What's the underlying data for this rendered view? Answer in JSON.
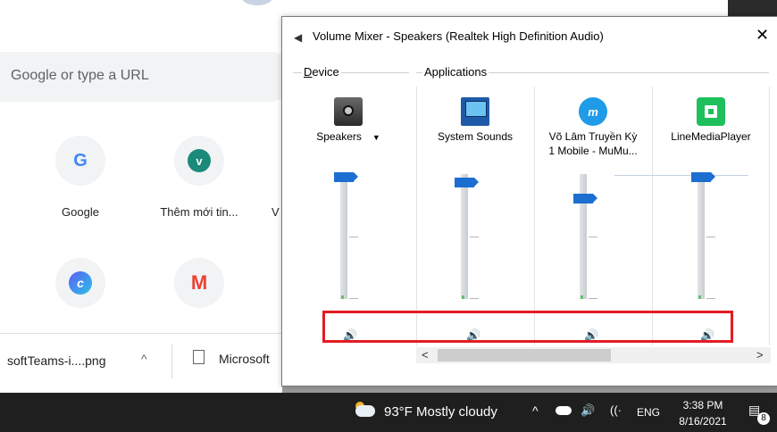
{
  "chrome": {
    "omnibox_placeholder": "Google or type a URL",
    "shortcuts": [
      {
        "label": "Google",
        "icon": "google-icon"
      },
      {
        "label": "Thêm mới tin...",
        "icon": "v-letter-icon"
      },
      {
        "label": "V",
        "icon": ""
      },
      {
        "label": "",
        "icon": "canva-icon"
      },
      {
        "label": "",
        "icon": "gmail-icon"
      }
    ],
    "downloads": [
      {
        "label": "softTeams-i....png"
      },
      {
        "label": "Microsoft"
      }
    ]
  },
  "mixer": {
    "title": "Volume Mixer - Speakers (Realtek High Definition Audio)",
    "close_label": "✕",
    "device_group_label": "Device",
    "applications_group_label": "Applications",
    "device": {
      "name": "Speakers",
      "icon": "speaker-icon",
      "volume_fraction": 0.97
    },
    "applications": [
      {
        "name": "System Sounds",
        "icon": "system-sounds-icon",
        "volume_fraction": 0.93
      },
      {
        "name": "Võ Lâm Truyền Kỳ\n1 Mobile - MuMu...",
        "name_line1": "Võ Lâm Truyền Kỳ",
        "name_line2": "1 Mobile - MuMu...",
        "icon": "mumu-icon",
        "volume_fraction": 0.8
      },
      {
        "name": "LineMediaPlayer",
        "icon": "line-media-player-icon",
        "volume_fraction": 0.97
      }
    ],
    "mute_icon": "speaker-volume-icon",
    "scroll_left": "<",
    "scroll_right": ">",
    "accent": "#1c6fd1",
    "highlight_color": "#e31b23"
  },
  "taskbar": {
    "weather": "93°F  Mostly cloudy",
    "tray_caret": "^",
    "language": "ENG",
    "time": "3:38 PM",
    "date": "8/16/2021",
    "notification_count": "8"
  }
}
